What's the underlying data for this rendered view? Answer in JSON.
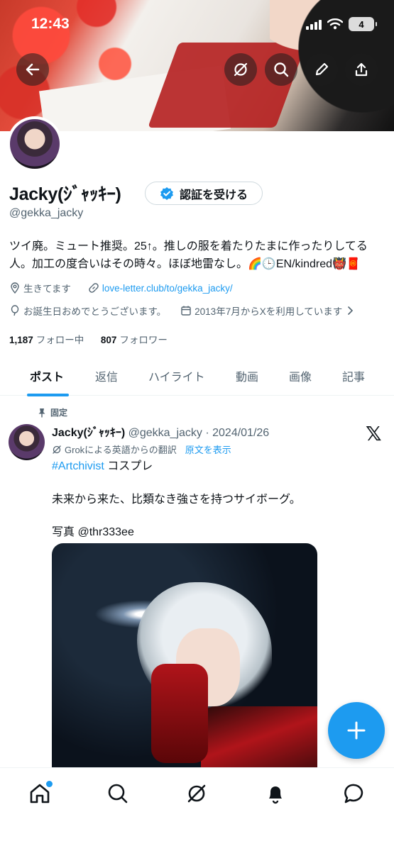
{
  "status_bar": {
    "time": "12:43",
    "battery": "4"
  },
  "header_actions": {
    "back": "back-arrow-icon",
    "grok": "grok-icon",
    "search": "search-icon",
    "edit": "pen-icon",
    "share": "share-icon"
  },
  "profile": {
    "name": "Jacky(ｼﾞｬｯｷｰ)",
    "verify_button": "認証を受ける",
    "handle": "@gekka_jacky",
    "bio_line1": "ツイ廃。ミュート推奨。25↑。推しの服を着たりたまに作ったりしてる",
    "bio_line2": "人。加工の度合いはその時々。ほぼ地雷なし。🌈🕒EN/kindred👹🧧",
    "location": "生きてます",
    "link": "love-letter.club/to/gekka_jacky/",
    "birthday": "お誕生日おめでとうございます。",
    "joined": "2013年7月からXを利用しています",
    "following_count": "1,187",
    "following_label": "フォロー中",
    "followers_count": "807",
    "followers_label": "フォロワー"
  },
  "tabs": [
    "ポスト",
    "返信",
    "ハイライト",
    "動画",
    "画像",
    "記事"
  ],
  "post": {
    "pinned_label": "固定",
    "author_name": "Jacky(ｼﾞｬｯｷｰ)",
    "author_handle_date": "@gekka_jacky · 2024/01/26",
    "translate_label": "Grokによる英語からの翻訳",
    "show_original": "原文を表示",
    "hashtag": "#Artchivist",
    "text_after_tag": " コスプレ",
    "line2": "未来から来た、比類なき強さを持つサイボーグ。",
    "line3": "写真 @thr333ee"
  },
  "colors": {
    "accent": "#1d9bf0",
    "text": "#0f1419",
    "muted": "#536471"
  }
}
